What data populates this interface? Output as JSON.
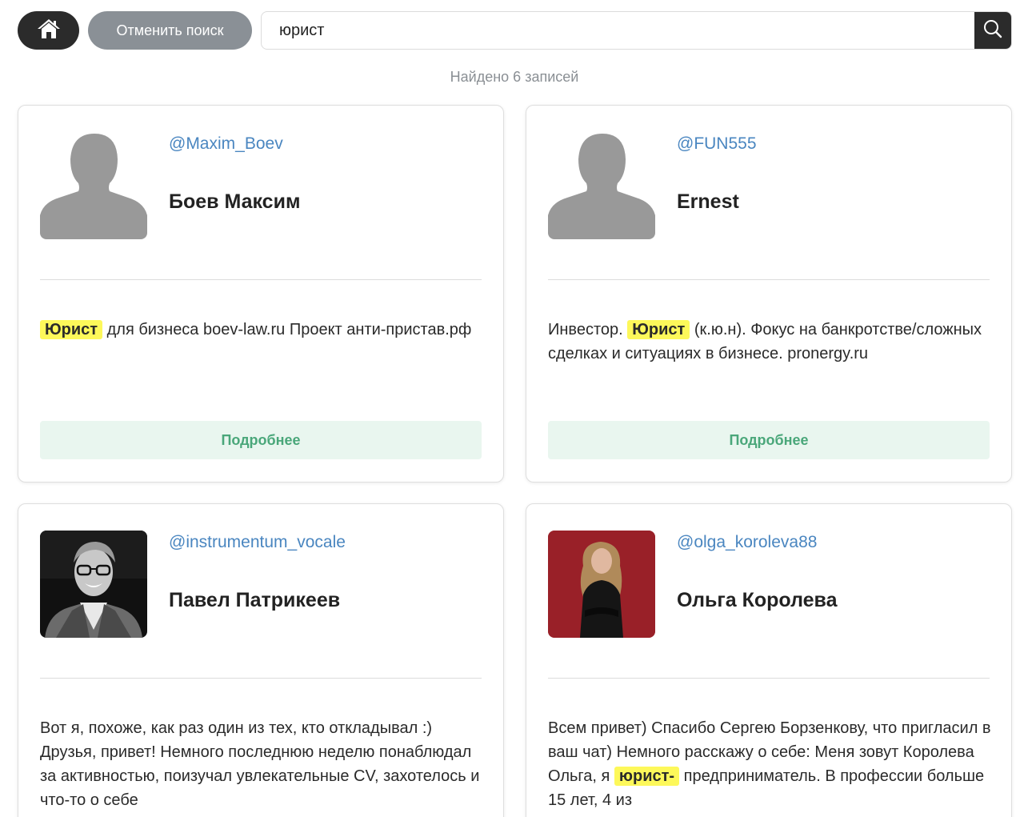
{
  "header": {
    "home_icon": "home-icon",
    "cancel_label": "Отменить поиск",
    "search_value": "юрист",
    "search_icon": "search-icon"
  },
  "results": {
    "count_text": "Найдено 6 записей"
  },
  "cards": [
    {
      "username": "@Maxim_Boev",
      "name": "Боев Максим",
      "avatar": "placeholder-person",
      "bio_highlight": "Юрист",
      "bio_pre": "",
      "bio_post": " для бизнеса boev-law.ru Проект анти-пристав.рф",
      "more_label": "Подробнее"
    },
    {
      "username": "@FUN555",
      "name": "Ernest",
      "avatar": "placeholder-person",
      "bio_pre": "Инвестор. ",
      "bio_highlight": "Юрист",
      "bio_post": " (к.ю.н). Фокус на банкротстве/сложных сделках и ситуациях в бизнесе. pronergy.ru",
      "more_label": "Подробнее"
    },
    {
      "username": "@instrumentum_vocale",
      "name": "Павел Патрикеев",
      "avatar": "photo-man-glasses",
      "bio_pre": "Вот я, похоже, как раз один из тех, кто откладывал :) Друзья, привет! Немного последнюю неделю понаблюдал за активностью, поизучал увлекательные CV, захотелось и что-то о себе",
      "bio_highlight": "",
      "bio_post": ""
    },
    {
      "username": "@olga_koroleva88",
      "name": "Ольга Королева",
      "avatar": "photo-woman-red-background",
      "bio_pre": "Всем привет) Спасибо Сергею Борзенкову, что пригласил в ваш чат) Немного расскажу о себе: Меня зовут Королева Ольга, я ",
      "bio_highlight": "юрист-",
      "bio_post": " предприниматель. В профессии больше 15 лет, 4 из"
    }
  ]
}
